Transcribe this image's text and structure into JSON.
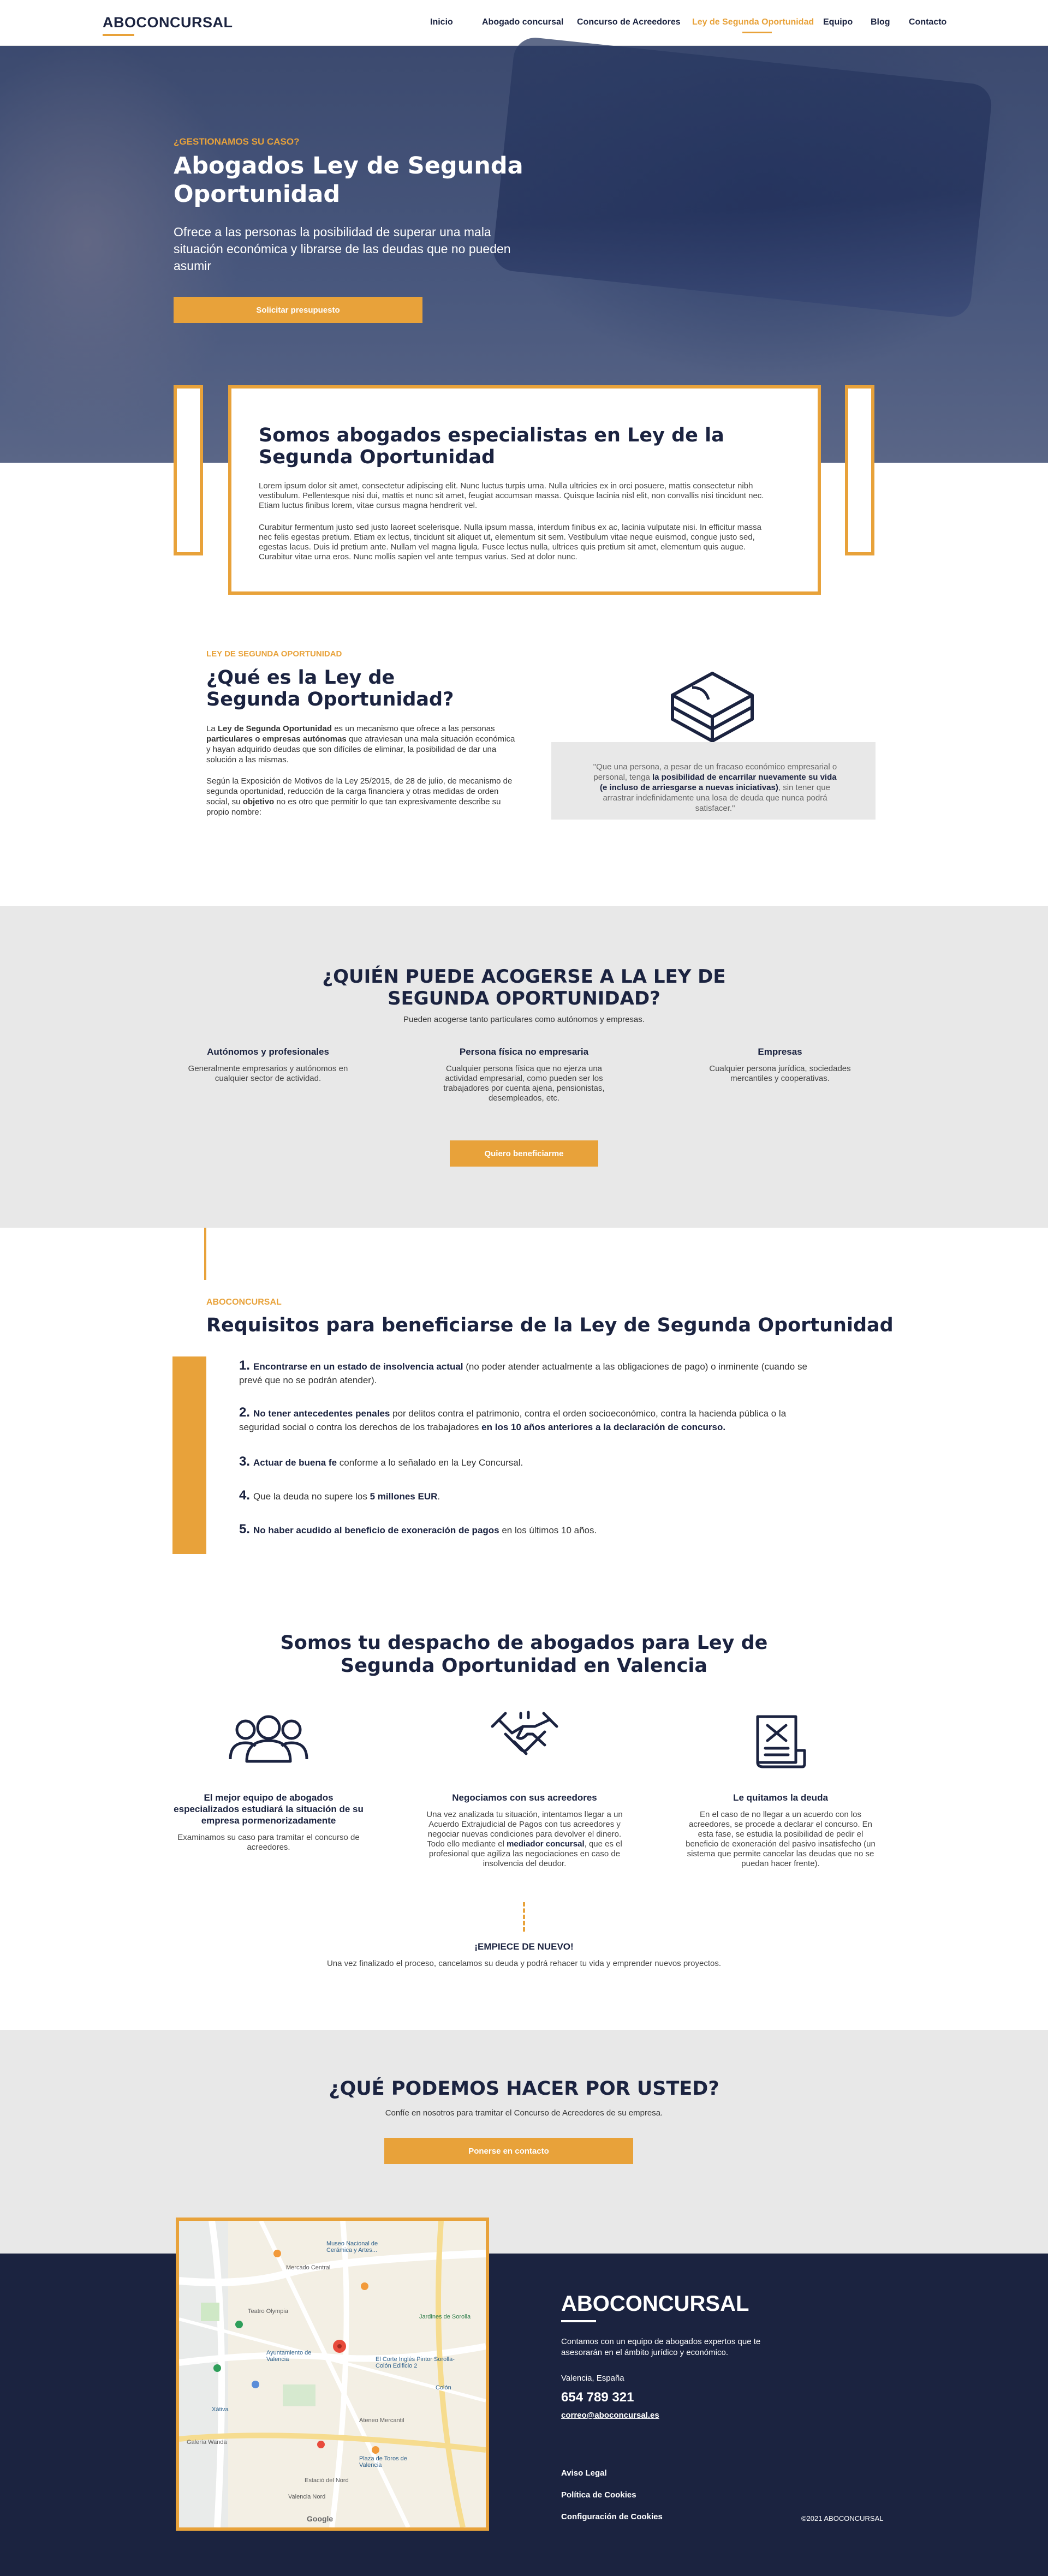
{
  "header": {
    "logo": "ABOCONCURSAL",
    "nav": [
      "Inicio",
      "Abogado concursal",
      "Concurso de Acreedores",
      "Ley de Segunda Oportunidad",
      "Equipo",
      "Blog",
      "Contacto"
    ]
  },
  "hero": {
    "eyebrow": "¿GESTIONAMOS SU CASO?",
    "title": "Abogados Ley de Segunda Oportunidad",
    "text": "Ofrece a las personas la posibilidad de superar una mala situación económica y librarse de las deudas que no pueden asumir",
    "button": "Solicitar presupuesto"
  },
  "intro": {
    "title": "Somos abogados especialistas en Ley de la Segunda Oportunidad",
    "p1": "Lorem ipsum dolor sit amet, consectetur adipiscing elit. Nunc luctus turpis urna. Nulla ultricies ex in orci posuere, mattis consectetur nibh vestibulum. Pellentesque nisi dui, mattis et nunc sit amet, feugiat accumsan massa. Quisque lacinia nisl elit, non convallis nisi tincidunt nec. Etiam luctus finibus lorem, vitae cursus magna hendrerit vel.",
    "p2": "Curabitur fermentum justo sed justo laoreet scelerisque. Nulla ipsum massa, interdum finibus ex ac, lacinia vulputate nisi. In efficitur massa nec felis egestas pretium. Etiam ex lectus, tincidunt sit aliquet ut, elementum sit sem. Vestibulum vitae neque euismod, congue justo sed, egestas lacus. Duis id pretium ante. Nullam vel magna ligula. Fusce lectus nulla, ultrices quis pretium sit amet, elementum quis augue. Curabitur vitae urna eros. Nunc mollis sapien vel ante tempus varius. Sed at dolor nunc."
  },
  "whatis": {
    "eyebrow": "LEY DE SEGUNDA OPORTUNIDAD",
    "title": "¿Qué es la Ley de Segunda Oportunidad?",
    "p1_a": "La ",
    "p1_b": "Ley de Segunda Oportunidad",
    "p1_c": " es un mecanismo que ofrece a las personas ",
    "p1_d": "particulares o empresas autónomas",
    "p1_e": " que atraviesan una mala situación económica y hayan adquirido deudas que son difíciles de eliminar, la posibilidad de dar una solución a las mismas.",
    "p2_a": "Según la Exposición de Motivos de la Ley 25/2015, de 28 de julio, de mecanismo de segunda oportunidad, reducción de la carga financiera y otras medidas de orden social, su ",
    "p2_b": "objetivo",
    "p2_c": " no es otro que permitir lo que tan expresivamente describe su propio nombre:",
    "quote_a": "\"Que una persona, a pesar de un fracaso económico empresarial o personal, tenga ",
    "quote_b": "la posibilidad de encarrilar nuevamente su vida (e incluso de arriesgarse a nuevas iniciativas)",
    "quote_c": ", sin tener que arrastrar indefinidamente una losa de deuda que nunca podrá satisfacer.\""
  },
  "who": {
    "title": "¿QUIÉN PUEDE ACOGERSE A LA LEY DE SEGUNDA OPORTUNIDAD?",
    "subtitle": "Pueden acogerse tanto particulares como autónomos y empresas.",
    "cols": [
      {
        "title": "Autónomos y profesionales",
        "text": "Generalmente empresarios y autónomos en cualquier sector de actividad."
      },
      {
        "title": "Persona física no empresaria",
        "text": "Cualquier persona física que no ejerza una actividad empresarial, como pueden ser los trabajadores por cuenta ajena, pensionistas, desempleados, etc."
      },
      {
        "title": "Empresas",
        "text": "Cualquier persona jurídica, sociedades mercantiles y cooperativas."
      }
    ],
    "button": "Quiero beneficiarme"
  },
  "req": {
    "eyebrow": "ABOCONCURSAL",
    "title": "Requisitos para beneficiarse de la Ley de Segunda Oportunidad",
    "items": [
      {
        "num": "1.",
        "bold": "Encontrarse en un estado de insolvencia actual",
        "text": " (no poder atender actualmente a las obligaciones de pago) o inminente (cuando se prevé que no se podrán atender)."
      },
      {
        "num": "2.",
        "bold": "No tener antecedentes penales",
        "text": " por delitos contra el patrimonio, contra el orden socioeconómico, contra la hacienda pública o la seguridad social o contra los derechos de los trabajadores ",
        "bold2": "en los 10 años anteriores a la declaración de concurso."
      },
      {
        "num": "3.",
        "bold": "Actuar de buena fe",
        "text": " conforme a lo señalado en la Ley Concursal."
      },
      {
        "num": "4.",
        "pre": "Que la deuda no supere los ",
        "bold": "5 millones EUR",
        "text": "."
      },
      {
        "num": "5.",
        "bold": "No haber acudido al beneficio de exoneración de pagos",
        "text": " en los últimos 10 años."
      }
    ]
  },
  "despacho": {
    "title": "Somos tu despacho de abogados para Ley de Segunda Oportunidad en Valencia",
    "cols": [
      {
        "icon": "team-icon",
        "title": "El mejor equipo de abogados especializados estudiará la situación de su empresa pormenorizadamente",
        "text": "Examinamos su caso para tramitar el concurso de acreedores."
      },
      {
        "icon": "handshake-icon",
        "title": "Negociamos con sus acreedores",
        "text_a": "Una vez analizada tu situación, intentamos llegar a un Acuerdo Extrajudicial de Pagos con tus acreedores y negociar nuevas condiciones para devolver el dinero. Todo ello mediante el ",
        "text_b": "mediador concursal",
        "text_c": ", que es el profesional que agiliza las negociaciones en caso de insolvencia del deudor."
      },
      {
        "icon": "debt-document-icon",
        "title": "Le quitamos la deuda",
        "text": "En el caso de no llegar a un acuerdo con los acreedores, se procede a declarar el concurso. En esta fase, se estudia la posibilidad de pedir el beneficio de exoneración del pasivo insatisfecho (un sistema que permite cancelar las deudas que no se puedan hacer frente)."
      }
    ],
    "again_title": "¡EMPIECE DE NUEVO!",
    "again_text": "Una vez finalizado el proceso, cancelamos su deuda y podrá rehacer tu vida y emprender nuevos proyectos."
  },
  "cta": {
    "title": "¿QUÉ PODEMOS HACER POR USTED?",
    "subtitle": "Confíe en nosotros para tramitar el Concurso de Acreedores de su empresa.",
    "button": "Ponerse en contacto"
  },
  "map": {
    "labels": [
      "Museo Nacional de Cerámica y Artes...",
      "Mercado Central",
      "Teatro Olympia",
      "Ayuntamiento de Valencia",
      "El Corte Inglés Pintor Sorolla-Colón Edificio 2",
      "Colón",
      "Ateneo Mercantil",
      "Plaza de Toros de Valencia",
      "Valencia Nord",
      "Estació del Nord",
      "Xàtiva",
      "Jardines de Sorolla",
      "Galería Wanda",
      "Google"
    ]
  },
  "footer": {
    "logo": "ABOCONCURSAL",
    "desc": "Contamos con un equipo de abogados expertos que te asesorarán en el ámbito jurídico y económico.",
    "city": "Valencia, España",
    "phone": "654 789 321",
    "email": "correo@aboconcursal.es",
    "links": [
      "Aviso Legal",
      "Política de Cookies",
      "Configuración de Cookies"
    ],
    "copyright": "©2021 ABOCONCURSAL"
  },
  "colors": {
    "accent": "#e8a23a",
    "navy": "#1b2340",
    "gray_section": "#e8e8e8"
  }
}
